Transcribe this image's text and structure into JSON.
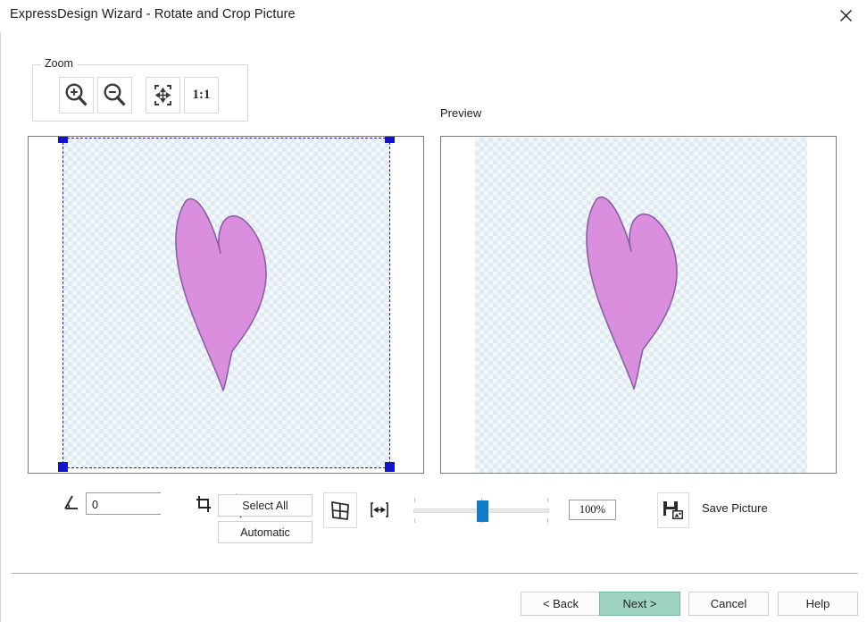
{
  "window": {
    "title": "ExpressDesign Wizard - Rotate and Crop Picture",
    "close_icon": "close-icon"
  },
  "zoom_group": {
    "label": "Zoom",
    "buttons": [
      {
        "name": "zoom-in-button",
        "icon": "magnifier-plus-icon",
        "label": ""
      },
      {
        "name": "zoom-out-button",
        "icon": "magnifier-minus-icon",
        "label": ""
      },
      {
        "name": "zoom-fit-button",
        "icon": "fit-to-window-icon",
        "label": ""
      },
      {
        "name": "zoom-actual-button",
        "icon": "one-to-one-icon",
        "label": "1:1"
      }
    ],
    "actual_size_label": "1:1"
  },
  "preview": {
    "label": "Preview"
  },
  "canvas": {
    "transparency_checker_light": "#f2f7fa",
    "transparency_checker_dark": "#dfeaf2",
    "selection_border_color": "#1a1a8c",
    "selection_handle_color": "#1212cf",
    "shape_fill": "#d98fdd",
    "shape_stroke": "#8a5fa8"
  },
  "toolbar": {
    "angle_icon": "angle-measure-icon",
    "angle_value": "0",
    "angle_stepper_up_icon": "triangle-up-icon",
    "angle_stepper_down_icon": "triangle-down-icon",
    "crop_icon": "crop-icon",
    "select_all_label": "Select All",
    "automatic_label": "Automatic",
    "perspective_icon": "perspective-grid-icon",
    "horizontal_resize_icon": "horizontal-resize-icon",
    "zoom_slider": {
      "value": 50,
      "min": 0,
      "max": 100,
      "thumb_color": "#1479c6"
    },
    "zoom_percent": "100%",
    "save_picture_icon": "save-image-icon",
    "save_picture_label": "Save Picture"
  },
  "footer": {
    "back_label": "< Back",
    "next_label": "Next >",
    "cancel_label": "Cancel",
    "help_label": "Help",
    "next_highlight_color": "#9fd4c2"
  }
}
